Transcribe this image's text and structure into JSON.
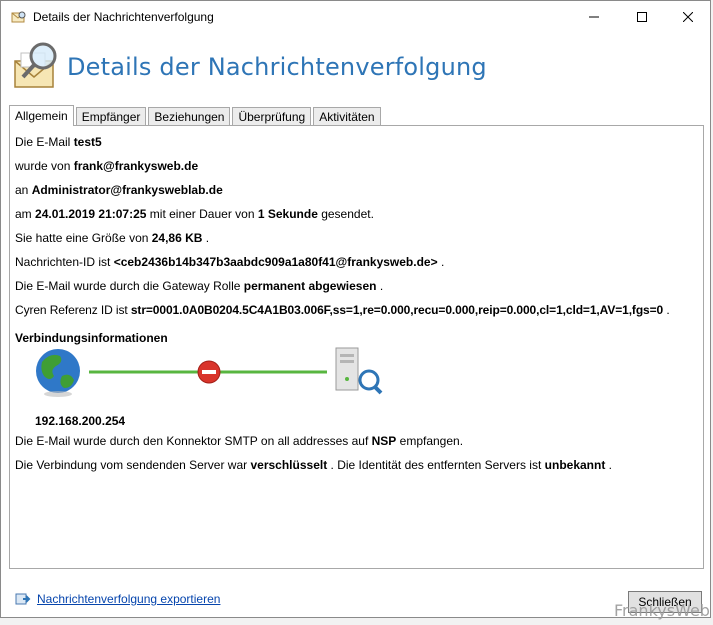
{
  "window": {
    "title": "Details der Nachrichtenverfolgung"
  },
  "header": {
    "title": "Details der Nachrichtenverfolgung"
  },
  "tabs": [
    {
      "label": "Allgemein",
      "active": true
    },
    {
      "label": "Empfänger",
      "active": false
    },
    {
      "label": "Beziehungen",
      "active": false
    },
    {
      "label": "Überprüfung",
      "active": false
    },
    {
      "label": "Aktivitäten",
      "active": false
    }
  ],
  "details": {
    "l1_pre": "Die E-Mail ",
    "subject": "test5",
    "l2_pre": "wurde von ",
    "sender": "frank@frankysweb.de",
    "l3_pre": "an ",
    "recipient": "Administrator@frankysweblab.de",
    "l4_pre": "am ",
    "datetime": "24.01.2019 21:07:25",
    "l4_mid": " mit einer Dauer von ",
    "duration": "1 Sekunde",
    "l4_post": " gesendet.",
    "l5_pre": "Sie hatte eine Größe von ",
    "size": "24,86 KB",
    "l5_post": " .",
    "l6_pre": "Nachrichten-ID ist ",
    "message_id": "<ceb2436b14b347b3aabdc909a1a80f41@frankysweb.de>",
    "l6_post": " .",
    "l7_pre": "Die E-Mail wurde durch die Gateway Rolle ",
    "status": "permanent abgewiesen",
    "l7_post": " .",
    "l8_pre": "Cyren Referenz ID ist ",
    "cyren_id": "str=0001.0A0B0204.5C4A1B03.006F,ss=1,re=0.000,recu=0.000,reip=0.000,cl=1,cld=1,AV=1,fgs=0",
    "l8_post": " ."
  },
  "connection": {
    "title": "Verbindungsinformationen",
    "ip": "192.168.200.254",
    "c1_pre": "Die E-Mail wurde durch den Konnektor SMTP on all addresses auf ",
    "server": "NSP",
    "c1_post": " empfangen.",
    "c2_pre": "Die Verbindung vom sendenden Server war ",
    "encryption": "verschlüsselt",
    "c2_mid": " . Die Identität des entfernten Servers ist ",
    "identity": "unbekannt",
    "c2_post": "  ."
  },
  "footer": {
    "export_link": "Nachrichtenverfolgung exportieren",
    "close_button": "Schließen",
    "watermark": "FrankysWeb"
  },
  "colors": {
    "accent": "#2e75b6",
    "link": "#0645ad",
    "line": "#58b640",
    "blocked": "#d9342b"
  }
}
